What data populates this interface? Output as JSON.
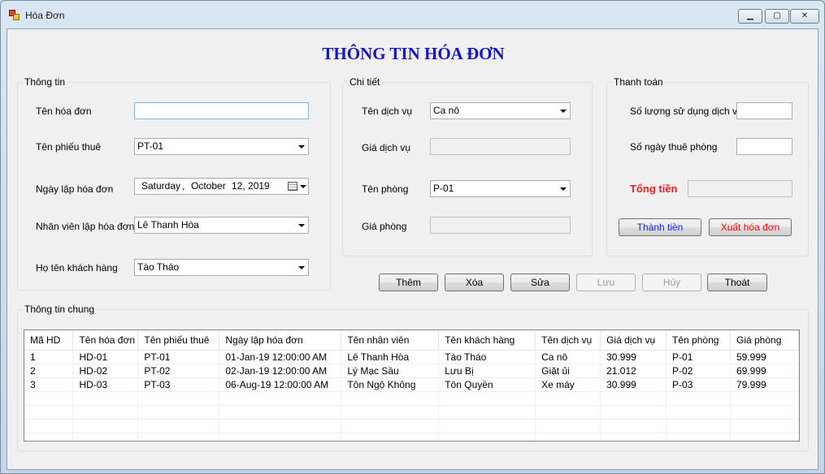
{
  "window": {
    "title": "Hóa Đơn",
    "minimize_icon": "minimize-icon",
    "maximize_icon": "maximize-icon",
    "close_icon": "close-icon"
  },
  "heading": "THÔNG TIN HÓA ĐƠN",
  "info": {
    "legend": "Thông tin",
    "invoice_name_label": "Tên hóa đơn",
    "invoice_name_value": "",
    "rental_slip_label": "Tên phiếu thuê",
    "rental_slip_value": "PT-01",
    "date_label": "Ngày lập hóa đơn",
    "date_weekday": "Saturday",
    "date_sep": ",",
    "date_month": "October",
    "date_rest": "12, 2019",
    "staff_label": "Nhân viên lập hóa đơn",
    "staff_value": "Lê Thanh Hòa",
    "customer_label": "Họ tên khách hàng",
    "customer_value": "Tào Tháo"
  },
  "detail": {
    "legend": "Chi tiết",
    "service_name_label": "Tên dịch vụ",
    "service_name_value": "Ca nô",
    "service_price_label": "Giá dịch vụ",
    "service_price_value": "",
    "room_name_label": "Tên phòng",
    "room_name_value": "P-01",
    "room_price_label": "Giá phòng",
    "room_price_value": ""
  },
  "payment": {
    "legend": "Thanh toán",
    "service_qty_label": "Số lượng sử dụng dịch vụ",
    "service_qty_value": "",
    "days_label": "Số ngày thuê phòng",
    "days_value": "",
    "total_label": "Tổng tiền",
    "total_value": "",
    "compute_button": "Thành tiền",
    "export_button": "Xuất hóa đơn"
  },
  "actions": {
    "add": "Thêm",
    "delete": "Xóa",
    "edit": "Sửa",
    "save": "Lưu",
    "cancel": "Hủy",
    "exit": "Thoát"
  },
  "general": {
    "legend": "Thông tin chung",
    "columns": [
      "Mã HD",
      "Tên hóa đơn",
      "Tên phiếu thuê",
      "Ngày lập hóa đơn",
      "Tên nhân viên",
      "Tên khách hàng",
      "Tên dịch vụ",
      "Giá dịch vụ",
      "Tên phòng",
      "Giá phòng"
    ],
    "rows": [
      [
        "1",
        "HD-01",
        "PT-01",
        "01-Jan-19 12:00:00 AM",
        "Lê Thanh Hòa",
        "Tào Tháo",
        "Ca nô",
        "30.999",
        "P-01",
        "59.999"
      ],
      [
        "2",
        "HD-02",
        "PT-02",
        "02-Jan-19 12:00:00 AM",
        "Lý Mạc Sầu",
        "Lưu Bị",
        "Giặt ủi",
        "21.012",
        "P-02",
        "69.999"
      ],
      [
        "3",
        "HD-03",
        "PT-03",
        "06-Aug-19 12:00:00 AM",
        "Tôn Ngộ Không",
        "Tôn Quyền",
        "Xe máy",
        "30.999",
        "P-03",
        "79.999"
      ]
    ]
  },
  "colors": {
    "heading": "#1414c8",
    "total_label": "#ff1a1a",
    "compute_button_text": "#1a1aff",
    "export_button_text": "#ff0000"
  }
}
